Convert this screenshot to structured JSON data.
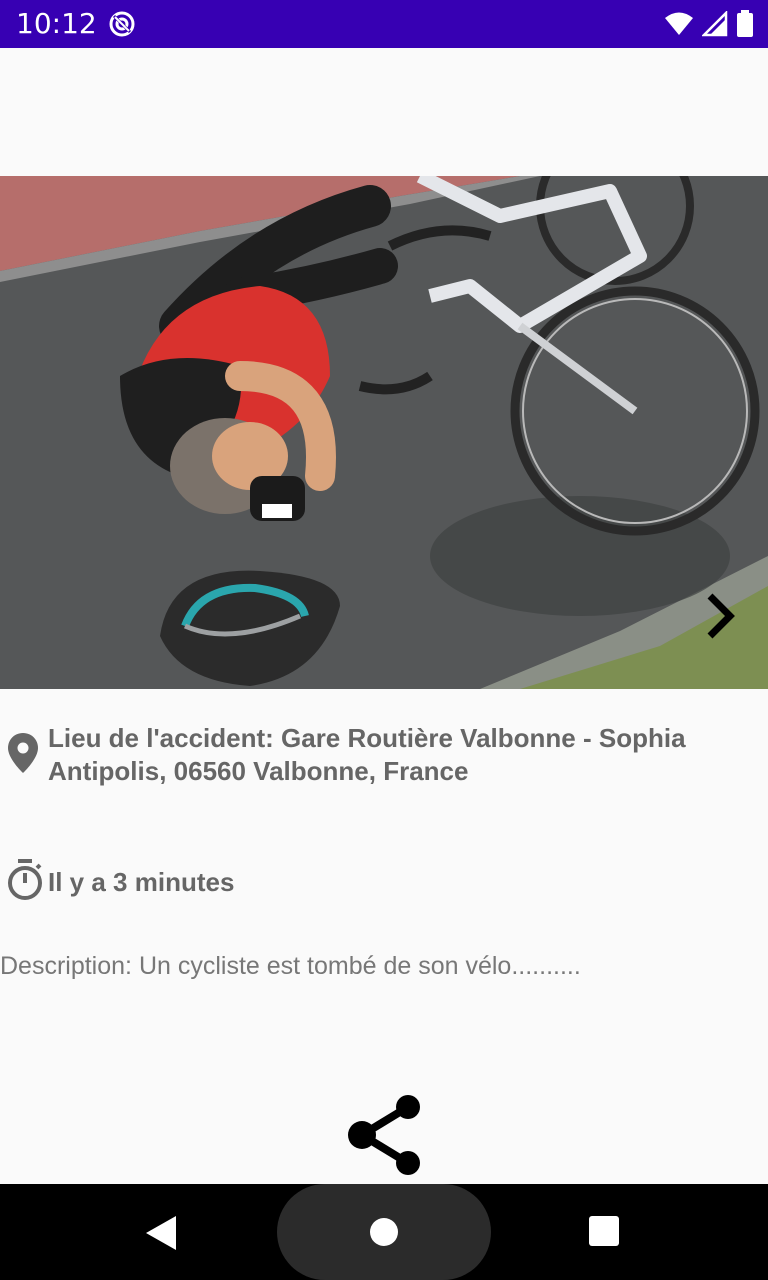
{
  "status_bar": {
    "time": "10:12",
    "icons": [
      "sync-icon",
      "wifi-icon",
      "signal-icon",
      "battery-icon"
    ],
    "background": "#3700b3"
  },
  "photo": {
    "description_icon": "accident-photo",
    "next_icon": "chevron-right-icon"
  },
  "location": {
    "icon": "location-pin-icon",
    "text": "Lieu de l'accident: Gare Routière Valbonne - Sophia Antipolis, 06560 Valbonne, France"
  },
  "time": {
    "icon": "stopwatch-icon",
    "text": "Il y a 3 minutes"
  },
  "description": {
    "text": "Description: Un cycliste est tombé de son vélo.........."
  },
  "actions": {
    "share_icon": "share-icon"
  },
  "nav_bar": {
    "icons": [
      "back-icon",
      "home-icon",
      "recents-icon"
    ]
  }
}
